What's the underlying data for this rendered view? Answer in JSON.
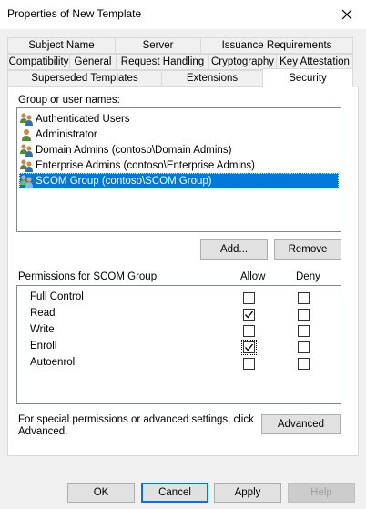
{
  "window": {
    "title": "Properties of New Template"
  },
  "tabs": {
    "row1": [
      {
        "label": "Subject Name"
      },
      {
        "label": "Server"
      },
      {
        "label": "Issuance Requirements"
      }
    ],
    "row2": [
      {
        "label": "Compatibility"
      },
      {
        "label": "General"
      },
      {
        "label": "Request Handling"
      },
      {
        "label": "Cryptography"
      },
      {
        "label": "Key Attestation"
      }
    ],
    "row3": [
      {
        "label": "Superseded Templates"
      },
      {
        "label": "Extensions"
      },
      {
        "label": "Security",
        "active": true
      }
    ]
  },
  "security": {
    "group_label": "Group or user names:",
    "users": [
      {
        "name": "Authenticated Users",
        "icon": "group-icon"
      },
      {
        "name": "Administrator",
        "icon": "user-icon"
      },
      {
        "name": "Domain Admins (contoso\\Domain Admins)",
        "icon": "group-icon"
      },
      {
        "name": "Enterprise Admins (contoso\\Enterprise Admins)",
        "icon": "group-icon"
      },
      {
        "name": "SCOM Group (contoso\\SCOM Group)",
        "icon": "group-icon",
        "selected": true
      }
    ],
    "add_label": "Add...",
    "remove_label": "Remove",
    "permissions_label": "Permissions for SCOM Group",
    "allow_header": "Allow",
    "deny_header": "Deny",
    "permissions": [
      {
        "name": "Full Control",
        "allow": false,
        "deny": false
      },
      {
        "name": "Read",
        "allow": true,
        "deny": false
      },
      {
        "name": "Write",
        "allow": false,
        "deny": false
      },
      {
        "name": "Enroll",
        "allow": true,
        "deny": false,
        "focused": true
      },
      {
        "name": "Autoenroll",
        "allow": false,
        "deny": false
      }
    ],
    "special_text_line1": "For special permissions or advanced settings, click",
    "special_text_line2": "Advanced.",
    "advanced_label": "Advanced"
  },
  "footer": {
    "ok_label": "OK",
    "cancel_label": "Cancel",
    "apply_label": "Apply",
    "help_label": "Help"
  },
  "colors": {
    "selection": "#0078d7",
    "dialog_bg": "#f0f0f0",
    "button_bg": "#e1e1e1"
  }
}
